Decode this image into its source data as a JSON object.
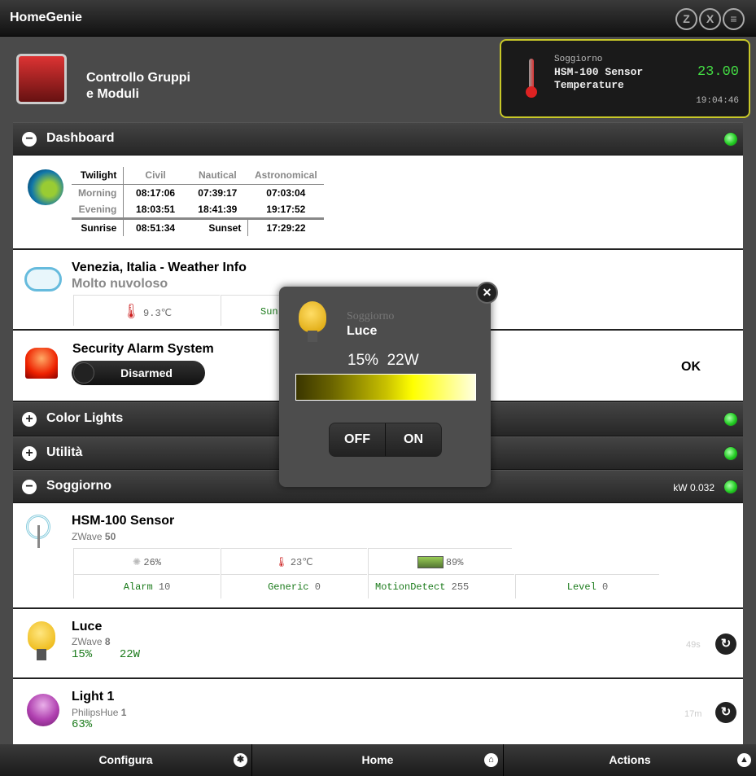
{
  "app": {
    "title": "HomeGenie",
    "toolbar_icons": [
      "zwave-icon",
      "x10-icon",
      "insteon-icon"
    ],
    "toolbar_glyphs": [
      "Z",
      "X",
      "≡"
    ]
  },
  "header": {
    "title_line1": "Controllo Gruppi",
    "title_line2": "e Moduli"
  },
  "widget": {
    "group": "Soggiorno",
    "name_line1": "HSM-100 Sensor",
    "name_line2": "Temperature",
    "value": "23.00",
    "time": "19:04:46"
  },
  "groups": [
    {
      "label": "Dashboard",
      "expanded": true,
      "sign": "−"
    },
    {
      "label": "Color Lights",
      "expanded": false,
      "sign": "+"
    },
    {
      "label": "Utilità",
      "expanded": false,
      "sign": "+"
    },
    {
      "label": "Soggiorno",
      "expanded": true,
      "sign": "−",
      "power": "kW 0.032"
    }
  ],
  "twilight": {
    "headers": [
      "Twilight",
      "Civil",
      "Nautical",
      "Astronomical"
    ],
    "rows": [
      [
        "Morning",
        "08:17:06",
        "07:39:17",
        "07:03:04"
      ],
      [
        "Evening",
        "18:03:51",
        "18:41:39",
        "19:17:52"
      ]
    ],
    "sunrise_label": "Sunrise",
    "sunrise": "08:51:34",
    "sunset_label": "Sunset",
    "sunset": "17:29:22"
  },
  "weather": {
    "title": "Venezia, Italia - Weather Info",
    "condition": "Molto nuvoloso",
    "temperature": "9.3℃",
    "cell2": "Sun"
  },
  "alarm": {
    "title": "Security Alarm System",
    "toggle": "Disarmed",
    "status": "OK"
  },
  "hsm": {
    "name": "HSM-100 Sensor",
    "type": "ZWave",
    "address": "50",
    "luminance": "26%",
    "temperature": "23℃",
    "battery": "89%",
    "params": [
      {
        "label": "Alarm",
        "value": "10"
      },
      {
        "label": "Generic",
        "value": "0"
      },
      {
        "label": "MotionDetect",
        "value": "255"
      },
      {
        "label": "Level",
        "value": "0"
      }
    ]
  },
  "luce": {
    "name": "Luce",
    "type": "ZWave",
    "address": "8",
    "level": "15%",
    "watts": "22W",
    "age": "49s"
  },
  "light1": {
    "name": "Light 1",
    "type": "PhilipsHue",
    "address": "1",
    "level": "63%",
    "age": "17m",
    "color": "#b040b0"
  },
  "popup": {
    "group": "Soggiorno",
    "name": "Luce",
    "level": "15%",
    "watts": "22W",
    "level_value": 15,
    "off": "OFF",
    "on": "ON",
    "close": "✕"
  },
  "footer": {
    "configure": "Configura",
    "home": "Home",
    "actions": "Actions"
  }
}
